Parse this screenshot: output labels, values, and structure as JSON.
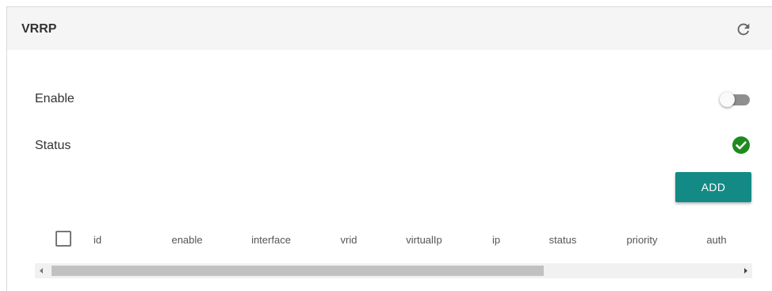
{
  "panel": {
    "title": "VRRP",
    "refresh_icon": "refresh-icon"
  },
  "settings": {
    "enable_label": "Enable",
    "enable_value": false,
    "status_label": "Status",
    "status_icon": "check-circle-icon",
    "status_color": "#1e8a1e"
  },
  "actions": {
    "add_label": "ADD",
    "add_color": "#138a86"
  },
  "table": {
    "select_all_checked": false,
    "columns": [
      "id",
      "enable",
      "interface",
      "vrid",
      "virtualIp",
      "ip",
      "status",
      "priority",
      "auth"
    ],
    "rows": []
  }
}
